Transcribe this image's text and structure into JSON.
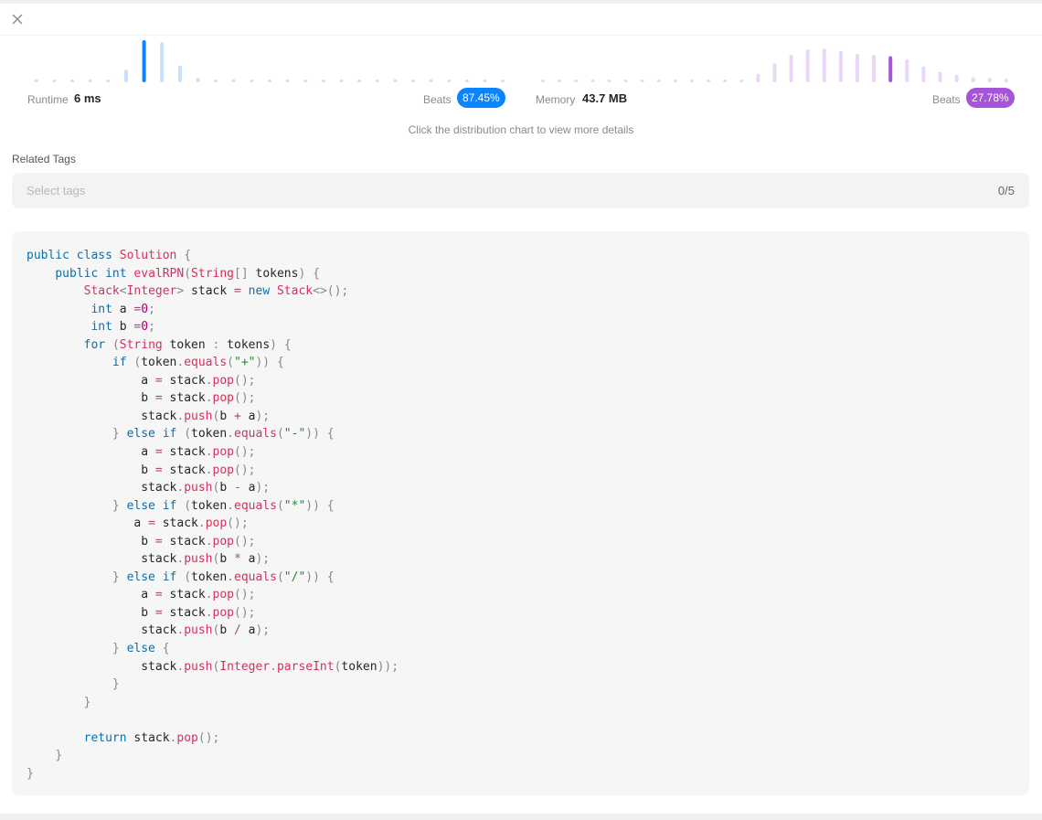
{
  "stats": {
    "runtime_label": "Runtime",
    "runtime_value": "6 ms",
    "runtime_beats_label": "Beats",
    "runtime_beats": "87.45%",
    "memory_label": "Memory",
    "memory_value": "43.7 MB",
    "memory_beats_label": "Beats",
    "memory_beats": "27.78%",
    "hint": "Click the distribution chart to view more details"
  },
  "colors": {
    "runtime_accent": "#0a84ff",
    "runtime_light": "#c7e1fb",
    "memory_accent": "#a654d9",
    "memory_light": "#ead6f6"
  },
  "charts": {
    "runtime_bars": [
      0.05,
      0.05,
      0.05,
      0.05,
      0.05,
      0.3,
      1.0,
      0.95,
      0.4,
      0.1,
      0.05,
      0.05,
      0.05,
      0.05,
      0.05,
      0.05,
      0.05,
      0.05,
      0.05,
      0.05,
      0.05,
      0.05,
      0.05,
      0.05,
      0.05,
      0.05,
      0.05
    ],
    "runtime_selected_index": 6,
    "memory_bars": [
      0.05,
      0.05,
      0.05,
      0.05,
      0.05,
      0.05,
      0.05,
      0.05,
      0.05,
      0.05,
      0.05,
      0.05,
      0.05,
      0.2,
      0.45,
      0.65,
      0.78,
      0.8,
      0.75,
      0.68,
      0.65,
      0.62,
      0.55,
      0.38,
      0.25,
      0.18,
      0.12,
      0.1,
      0.08
    ]
  },
  "tags": {
    "title": "Related Tags",
    "placeholder": "Select tags",
    "count": "0/5"
  }
}
